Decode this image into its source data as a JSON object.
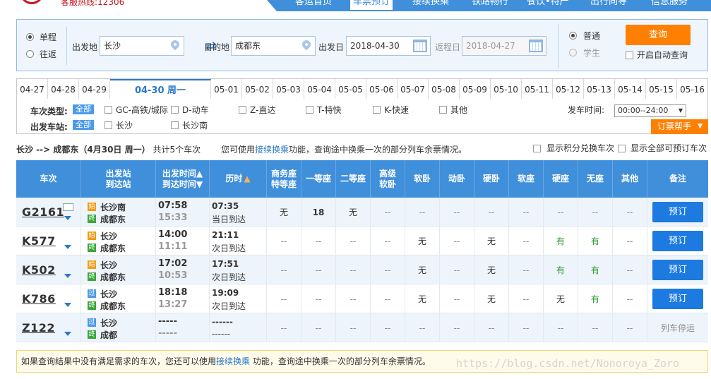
{
  "header": {
    "hotline": "客服热线:12306",
    "nav": [
      "客运首页",
      "车票预订",
      "接续换乘",
      "铁路畅行",
      "餐饮•特产",
      "出行向导",
      "信息服务"
    ],
    "active_nav": "车票预订"
  },
  "search": {
    "trip_type": {
      "oneway": "单程",
      "roundtrip": "往返"
    },
    "from_label": "出发地",
    "from_value": "长沙",
    "to_label": "目的地",
    "to_value": "成都东",
    "depart_label": "出发日",
    "depart_value": "2018-04-30",
    "return_label": "返程日",
    "return_value": "2018-04-27",
    "passenger": {
      "normal": "普通",
      "student": "学生"
    },
    "query_button": "查询",
    "auto_query": "开启自动查询"
  },
  "dates": [
    "04-27",
    "04-28",
    "04-29",
    "04-30 周一",
    "05-01",
    "05-02",
    "05-03",
    "05-04",
    "05-05",
    "05-06",
    "05-07",
    "05-08",
    "05-09",
    "05-10",
    "05-11",
    "05-12",
    "05-13",
    "05-14",
    "05-15",
    "05-16"
  ],
  "filters": {
    "type_label": "车次类型:",
    "all": "全部",
    "types": [
      "GC-高铁/城际",
      "D-动车",
      "Z-直达",
      "T-特快",
      "K-快速",
      "其他"
    ],
    "station_label": "出发车站:",
    "stations": [
      "长沙",
      "长沙南"
    ],
    "time_label": "发车时间:",
    "time_value": "00:00--24:00",
    "helper": "订票帮手"
  },
  "summary": {
    "route": "长沙 --> 成都东（4月30日 周一）",
    "count_text": "共计5个车次",
    "tip_pre": "您可使用",
    "tip_link": "接续换乘",
    "tip_post": "功能，查询途中换乘一次的部分列车余票情况。",
    "opt_points": "显示积分兑换车次",
    "opt_all": "显示全部可预订车次"
  },
  "table": {
    "headers": {
      "train": "车次",
      "station": [
        "出发站",
        "到达站"
      ],
      "time": [
        "出发时间",
        "到达时间"
      ],
      "duration": "历时",
      "seats": [
        [
          "商务座",
          "特等座"
        ],
        [
          "一等座"
        ],
        [
          "二等座"
        ],
        [
          "高级",
          "软卧"
        ],
        [
          "软卧"
        ],
        [
          "动卧"
        ],
        [
          "硬卧"
        ],
        [
          "软座"
        ],
        [
          "硬座"
        ],
        [
          "无座"
        ],
        [
          "其他"
        ]
      ],
      "remark": "备注"
    },
    "rows": [
      {
        "no": "G2161",
        "from": "长沙南",
        "from_tag": "始",
        "to": "成都东",
        "to_tag": "终",
        "dep": "07:58",
        "arr": "15:33",
        "dur": "07:35",
        "day": "当日到达",
        "seats": [
          "无",
          "18",
          "无",
          "--",
          "--",
          "--",
          "--",
          "--",
          "--",
          "--",
          "--"
        ],
        "action": "预订",
        "has_card": true
      },
      {
        "no": "K577",
        "from": "长沙",
        "from_tag": "始",
        "to": "成都东",
        "to_tag": "终",
        "dep": "14:00",
        "arr": "11:11",
        "dur": "21:11",
        "day": "次日到达",
        "seats": [
          "--",
          "--",
          "--",
          "--",
          "无",
          "--",
          "无",
          "--",
          "有",
          "有",
          "--"
        ],
        "action": "预订",
        "has_card": false
      },
      {
        "no": "K502",
        "from": "长沙",
        "from_tag": "始",
        "to": "成都东",
        "to_tag": "终",
        "dep": "17:02",
        "arr": "10:53",
        "dur": "17:51",
        "day": "次日到达",
        "seats": [
          "--",
          "--",
          "--",
          "--",
          "无",
          "--",
          "无",
          "--",
          "有",
          "有",
          "--"
        ],
        "action": "预订",
        "has_card": false
      },
      {
        "no": "K786",
        "from": "长沙",
        "from_tag": "过",
        "to": "成都东",
        "to_tag": "终",
        "dep": "18:18",
        "arr": "13:27",
        "dur": "19:09",
        "day": "次日到达",
        "seats": [
          "--",
          "--",
          "--",
          "--",
          "无",
          "--",
          "无",
          "--",
          "无",
          "有",
          "--"
        ],
        "action": "预订",
        "has_card": false
      },
      {
        "no": "Z122",
        "from": "长沙",
        "from_tag": "过",
        "to": "成都",
        "to_tag": "终",
        "dep": "-----",
        "arr": "-----",
        "dur": "------",
        "day": "------",
        "seats": [
          "--",
          "--",
          "--",
          "--",
          "--",
          "--",
          "--",
          "--",
          "--",
          "--",
          "--"
        ],
        "action": "列车停运",
        "has_card": false
      }
    ]
  },
  "notice": {
    "pre": "如果查询结果中没有满足需求的车次，您还可以使用",
    "link": "接续换乘",
    "post": " 功能，查询途中换乘一次的部分列车余票情况。"
  },
  "watermark": "https://blog.csdn.net/Nonoroya_Zoro",
  "colors": {
    "primary": "#3f8fdb",
    "accent": "#ff8000",
    "book": "#1c7ae0",
    "available": "#2a9a2a"
  }
}
